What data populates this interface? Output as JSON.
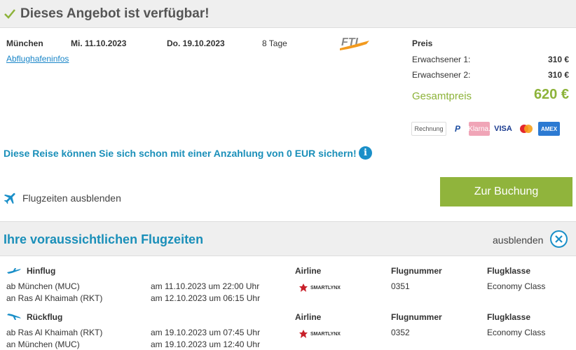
{
  "header": {
    "title": "Dieses Angebot ist verfügbar!"
  },
  "offer": {
    "from": "München",
    "depart_date": "Mi. 11.10.2023",
    "return_date": "Do. 19.10.2023",
    "duration": "8 Tage",
    "airport_link": "Abflughafeninfos",
    "operator_logo": "FTI"
  },
  "price": {
    "heading": "Preis",
    "adult1_label": "Erwachsener 1:",
    "adult1_value": "310 €",
    "adult2_label": "Erwachsener 2:",
    "adult2_value": "310 €",
    "total_label": "Gesamtpreis",
    "total_value": "620 €"
  },
  "payment": {
    "rechnung": "Rechnung",
    "paypal": "P",
    "klarna": "Klarna.",
    "visa": "VISA",
    "amex": "AMEX"
  },
  "deposit_text": "Diese Reise können Sie sich schon mit einer Anzahlung von 0 EUR sichern!",
  "info_icon": "i",
  "flight_toggle_label": "Flugzeiten ausblenden",
  "book_button": "Zur Buchung",
  "flight_section": {
    "title": "Ihre voraussichtlichen Flugzeiten",
    "hide_label": "ausblenden",
    "columns": {
      "airline": "Airline",
      "flight_number": "Flugnummer",
      "class": "Flugklasse"
    },
    "outbound": {
      "label": "Hinflug",
      "dep": "ab München (MUC)",
      "dep_time": "am 11.10.2023 um 22:00 Uhr",
      "arr": "an Ras Al Khaimah (RKT)",
      "arr_time": "am 12.10.2023 um 06:15 Uhr",
      "airline_logo": "SMARTLYNX",
      "flight_number": "0351",
      "class": "Economy Class"
    },
    "return": {
      "label": "Rückflug",
      "dep": "ab Ras Al Khaimah (RKT)",
      "dep_time": "am 19.10.2023 um 07:45 Uhr",
      "arr": "an München (MUC)",
      "arr_time": "am 19.10.2023 um 12:40 Uhr",
      "airline_logo": "SMARTLYNX",
      "flight_number": "0352",
      "class": "Economy Class"
    }
  }
}
